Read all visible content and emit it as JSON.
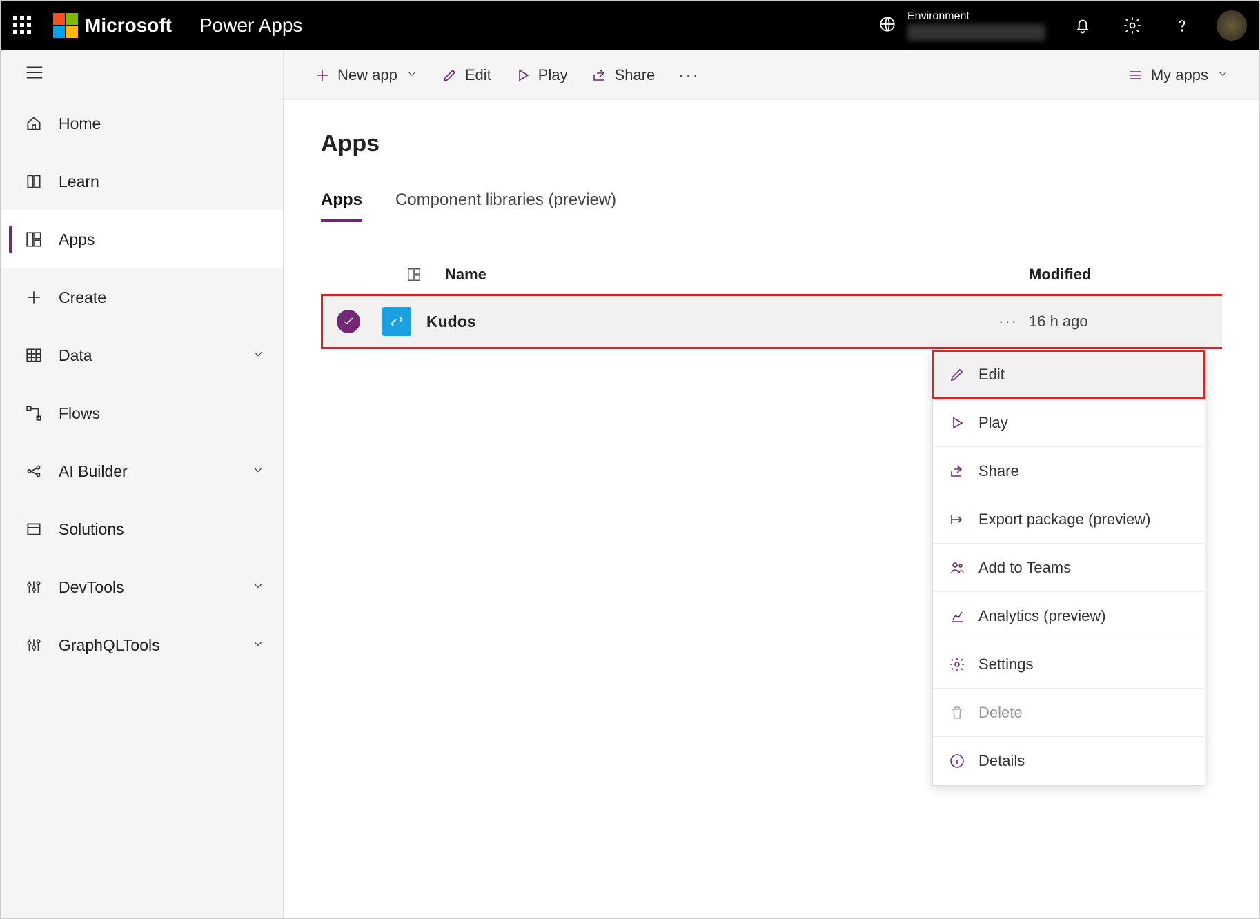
{
  "header": {
    "brand": "Microsoft",
    "product": "Power Apps",
    "environment_label": "Environment"
  },
  "nav": {
    "items": [
      {
        "label": "Home",
        "icon": "home",
        "expandable": false,
        "active": false
      },
      {
        "label": "Learn",
        "icon": "book",
        "expandable": false,
        "active": false
      },
      {
        "label": "Apps",
        "icon": "apps",
        "expandable": false,
        "active": true
      },
      {
        "label": "Create",
        "icon": "plus",
        "expandable": false,
        "active": false
      },
      {
        "label": "Data",
        "icon": "table",
        "expandable": true,
        "active": false
      },
      {
        "label": "Flows",
        "icon": "flow",
        "expandable": false,
        "active": false
      },
      {
        "label": "AI Builder",
        "icon": "ai",
        "expandable": true,
        "active": false
      },
      {
        "label": "Solutions",
        "icon": "solution",
        "expandable": false,
        "active": false
      },
      {
        "label": "DevTools",
        "icon": "tools",
        "expandable": true,
        "active": false
      },
      {
        "label": "GraphQLTools",
        "icon": "tools",
        "expandable": true,
        "active": false
      }
    ]
  },
  "commandbar": {
    "new_app": "New app",
    "edit": "Edit",
    "play": "Play",
    "share": "Share",
    "view_selector": "My apps"
  },
  "page": {
    "title": "Apps",
    "tabs": [
      {
        "label": "Apps",
        "active": true
      },
      {
        "label": "Component libraries (preview)",
        "active": false
      }
    ],
    "columns": {
      "name": "Name",
      "modified": "Modified"
    },
    "rows": [
      {
        "name": "Kudos",
        "modified": "16 h ago",
        "selected": true
      }
    ]
  },
  "context_menu": {
    "items": [
      {
        "label": "Edit",
        "icon": "edit",
        "highlight": true,
        "disabled": false
      },
      {
        "label": "Play",
        "icon": "play",
        "highlight": false,
        "disabled": false
      },
      {
        "label": "Share",
        "icon": "share",
        "highlight": false,
        "disabled": false
      },
      {
        "label": "Export package (preview)",
        "icon": "export",
        "highlight": false,
        "disabled": false
      },
      {
        "label": "Add to Teams",
        "icon": "teams",
        "highlight": false,
        "disabled": false
      },
      {
        "label": "Analytics (preview)",
        "icon": "analytics",
        "highlight": false,
        "disabled": false
      },
      {
        "label": "Settings",
        "icon": "settings",
        "highlight": false,
        "disabled": false
      },
      {
        "label": "Delete",
        "icon": "delete",
        "highlight": false,
        "disabled": true
      },
      {
        "label": "Details",
        "icon": "info",
        "highlight": false,
        "disabled": false
      }
    ]
  }
}
